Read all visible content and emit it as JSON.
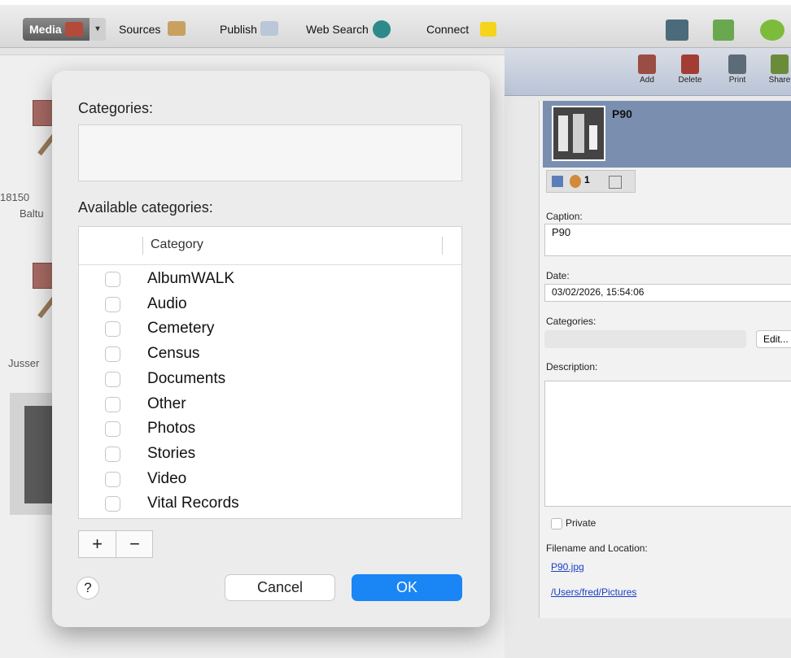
{
  "toolbar": {
    "tabs": [
      "Media",
      "Sources",
      "Publish",
      "Web Search",
      "Connect"
    ],
    "right_buttons": [
      "Add",
      "Delete",
      "Print",
      "Share"
    ]
  },
  "left": {
    "item1_label_a": "18150",
    "item1_label_b": "Baltu",
    "item2_label": "Jusser"
  },
  "detail": {
    "photo_title": "P90",
    "tab_count": "1",
    "caption_label": "Caption:",
    "caption_value": "P90",
    "date_label": "Date:",
    "date_value": "03/02/2026, 15:54:06",
    "categories_label": "Categories:",
    "edit_button": "Edit...",
    "description_label": "Description:",
    "private_label": "Private",
    "file_label": "Filename and Location:",
    "filename": "P90.jpg",
    "location": "/Users/fred/Pictures"
  },
  "dialog": {
    "categories_label": "Categories:",
    "available_label": "Available categories:",
    "column_header": "Category",
    "items": [
      {
        "label": "AlbumWALK",
        "checked": false
      },
      {
        "label": "Audio",
        "checked": false
      },
      {
        "label": "Cemetery",
        "checked": false
      },
      {
        "label": "Census",
        "checked": false
      },
      {
        "label": "Documents",
        "checked": false
      },
      {
        "label": "Other",
        "checked": false
      },
      {
        "label": "Photos",
        "checked": false
      },
      {
        "label": "Stories",
        "checked": false
      },
      {
        "label": "Video",
        "checked": false
      },
      {
        "label": "Vital Records",
        "checked": false
      }
    ],
    "plus": "+",
    "minus": "−",
    "help": "?",
    "cancel": "Cancel",
    "ok": "OK"
  },
  "colors": {
    "accent": "#1a85f5",
    "link": "#1a3ec8",
    "photo_header": "#7a8fb0"
  }
}
